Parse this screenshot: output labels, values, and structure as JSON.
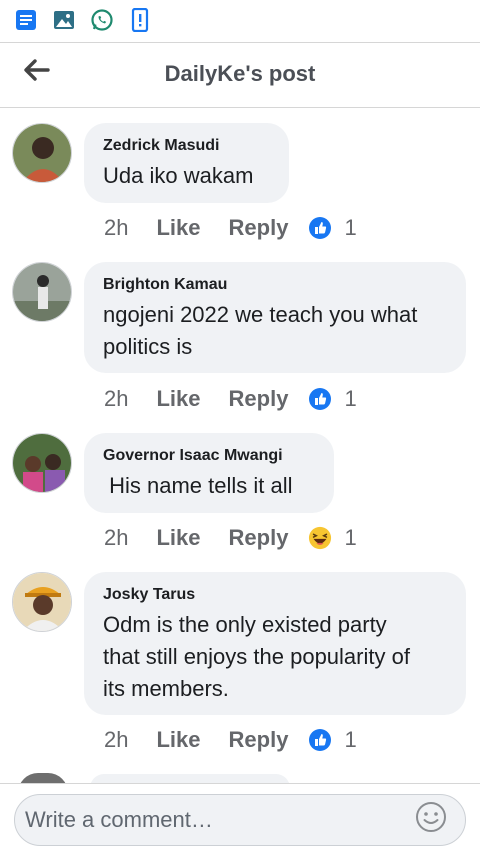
{
  "status_bar": {
    "icons": [
      "message-icon",
      "gallery-icon",
      "whatsapp-icon",
      "phone-alert-icon"
    ]
  },
  "header": {
    "title": "DailyKe's post",
    "back_icon": "back-arrow-icon"
  },
  "comments": [
    {
      "author": "Zedrick Masudi",
      "text": "Uda iko wakam",
      "time": "2h",
      "like_label": "Like",
      "reply_label": "Reply",
      "reaction": "like",
      "reaction_count": "1"
    },
    {
      "author": "Brighton Kamau",
      "text": "ngojeni 2022 we teach you what\npolitics is",
      "time": "2h",
      "like_label": "Like",
      "reply_label": "Reply",
      "reaction": "like",
      "reaction_count": "1"
    },
    {
      "author": "Governor Isaac Mwangi",
      "text": " His name tells it all",
      "time": "2h",
      "like_label": "Like",
      "reply_label": "Reply",
      "reaction": "haha",
      "reaction_count": "1"
    },
    {
      "author": "Josky Tarus",
      "text": "Odm is the only existed party\nthat still enjoys the popularity of\nits members.",
      "time": "2h",
      "like_label": "Like",
      "reply_label": "Reply",
      "reaction": "like",
      "reaction_count": "1"
    }
  ],
  "composer": {
    "placeholder": "Write a comment…"
  },
  "colors": {
    "bubble": "#f0f2f5",
    "like_blue": "#1877f2",
    "muted_text": "#65676b"
  }
}
